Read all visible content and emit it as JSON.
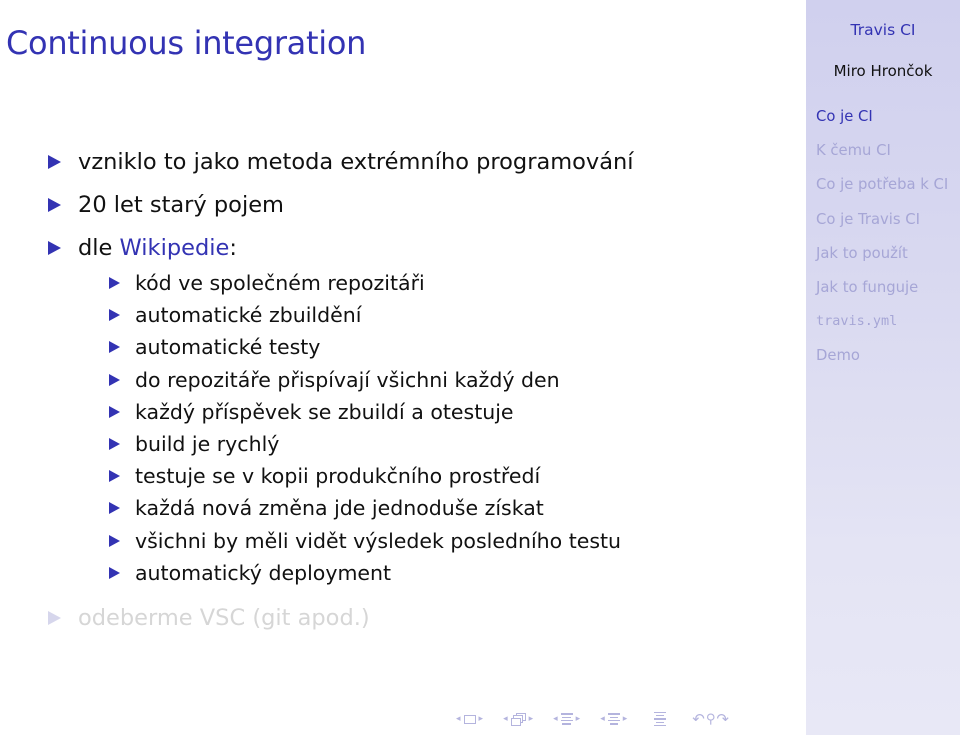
{
  "slide": {
    "title": "Continuous integration",
    "items": [
      {
        "text": "vzniklo to jako metoda extrémního programování"
      },
      {
        "text": "20 let starý pojem"
      },
      {
        "prefix": "dle ",
        "link": "Wikipedie",
        "suffix": ":",
        "subitems": [
          "kód ve společném repozitáři",
          "automatické zbuildění",
          "automatické testy",
          "do repozitáře přispívají všichni každý den",
          "každý příspěvek se zbuildí a otestuje",
          "build je rychlý",
          "testuje se v kopii produkčního prostředí",
          "každá nová změna jde jednoduše získat",
          "všichni by měli vidět výsledek posledního testu",
          "automatický deployment"
        ]
      },
      {
        "text": "odeberme VSC (git apod.)",
        "state": "dimmed"
      }
    ]
  },
  "sidebar": {
    "title": "Travis CI",
    "author": "Miro Hrončok",
    "sections": [
      {
        "label": "Co je CI",
        "active": true
      },
      {
        "label": "K čemu CI",
        "active": false
      },
      {
        "label": "Co je potřeba k CI",
        "active": false
      },
      {
        "label": "Co je Travis CI",
        "active": false
      },
      {
        "label": "Jak to použít",
        "active": false
      },
      {
        "label": "Jak to funguje",
        "active": false
      },
      {
        "label": "travis.yml",
        "active": false,
        "monospace": true
      },
      {
        "label": "Demo",
        "active": false
      }
    ]
  },
  "navigation": {
    "arrow_left": "◂",
    "arrow_right": "▸",
    "icons": [
      "slide-icon",
      "frame-icon",
      "subsection-icon",
      "section-icon",
      "document-icon",
      "back-icon",
      "search-icon",
      "forward-icon"
    ],
    "back_glyph": "↶",
    "search_glyph": "⚲",
    "forward_glyph": "↷"
  },
  "colors": {
    "accent": "#3333b3",
    "text": "#111111",
    "dimmed_text": "#d6d6d6",
    "sidebar_bg": "#d0d0ee",
    "sidebar_inactive": "#a6a6d6",
    "nav_icons": "#b4b4de"
  }
}
